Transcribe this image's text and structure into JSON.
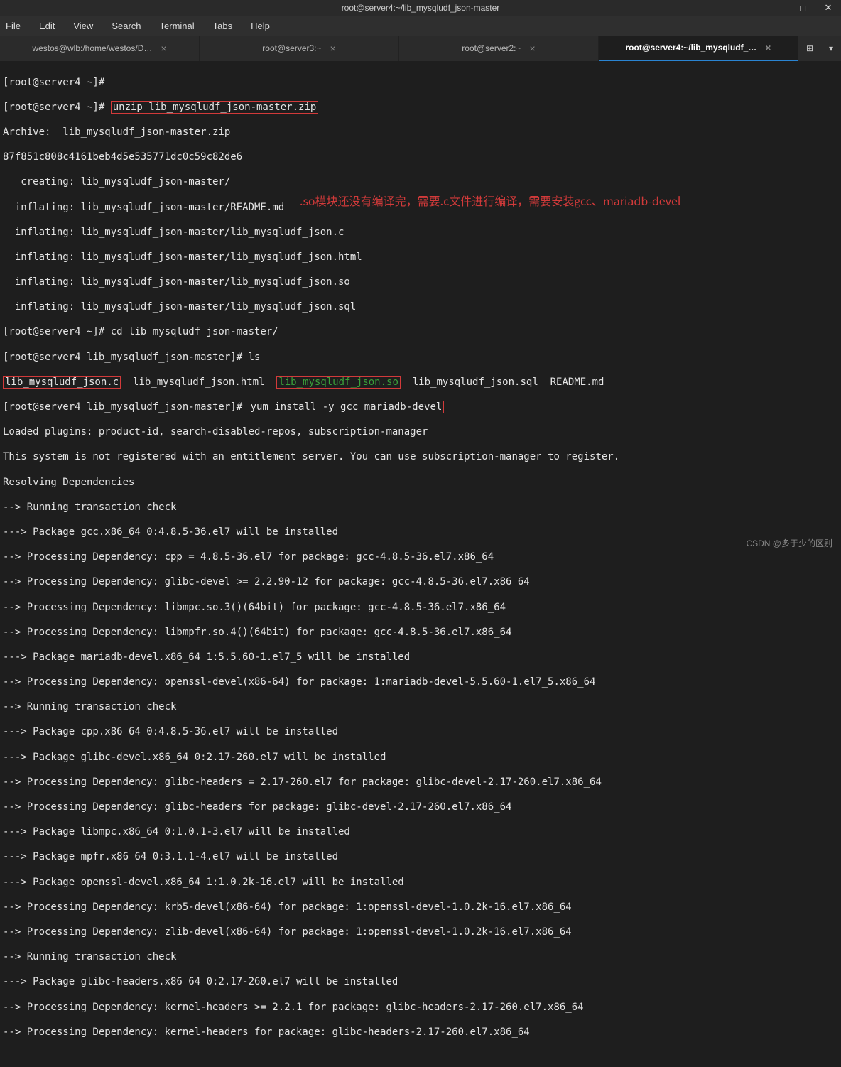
{
  "window": {
    "title": "root@server4:~/lib_mysqludf_json-master"
  },
  "menu": {
    "file": "File",
    "edit": "Edit",
    "view": "View",
    "search": "Search",
    "terminal": "Terminal",
    "tabs": "Tabs",
    "help": "Help"
  },
  "tabs": [
    {
      "label": "westos@wlb:/home/westos/D…",
      "active": false
    },
    {
      "label": "root@server3:~",
      "active": false
    },
    {
      "label": "root@server2:~",
      "active": false
    },
    {
      "label": "root@server4:~/lib_mysqludf_…",
      "active": true
    }
  ],
  "terminal": {
    "line01": "[root@server4 ~]#",
    "line02a": "[root@server4 ~]# ",
    "line02b": "unzip lib_mysqludf_json-master.zip",
    "line03": "Archive:  lib_mysqludf_json-master.zip",
    "line04": "87f851c808c4161beb4d5e535771dc0c59c82de6",
    "line05": "   creating: lib_mysqludf_json-master/",
    "line06": "  inflating: lib_mysqludf_json-master/README.md",
    "line07": "  inflating: lib_mysqludf_json-master/lib_mysqludf_json.c",
    "line08": "  inflating: lib_mysqludf_json-master/lib_mysqludf_json.html",
    "line09": "  inflating: lib_mysqludf_json-master/lib_mysqludf_json.so",
    "line10": "  inflating: lib_mysqludf_json-master/lib_mysqludf_json.sql",
    "line11": "[root@server4 ~]# cd lib_mysqludf_json-master/",
    "line12": "[root@server4 lib_mysqludf_json-master]# ls",
    "line13a": "lib_mysqludf_json.c",
    "line13b": "  lib_mysqludf_json.html  ",
    "line13c": "lib_mysqludf_json.so",
    "line13d": "  lib_mysqludf_json.sql  README.md",
    "line14a": "[root@server4 lib_mysqludf_json-master]# ",
    "line14b": "yum install -y gcc mariadb-devel",
    "line15": "Loaded plugins: product-id, search-disabled-repos, subscription-manager",
    "line16": "This system is not registered with an entitlement server. You can use subscription-manager to register.",
    "line17": "Resolving Dependencies",
    "line18": "--> Running transaction check",
    "line19": "---> Package gcc.x86_64 0:4.8.5-36.el7 will be installed",
    "line20": "--> Processing Dependency: cpp = 4.8.5-36.el7 for package: gcc-4.8.5-36.el7.x86_64",
    "line21": "--> Processing Dependency: glibc-devel >= 2.2.90-12 for package: gcc-4.8.5-36.el7.x86_64",
    "line22": "--> Processing Dependency: libmpc.so.3()(64bit) for package: gcc-4.8.5-36.el7.x86_64",
    "line23": "--> Processing Dependency: libmpfr.so.4()(64bit) for package: gcc-4.8.5-36.el7.x86_64",
    "line24": "---> Package mariadb-devel.x86_64 1:5.5.60-1.el7_5 will be installed",
    "line25": "--> Processing Dependency: openssl-devel(x86-64) for package: 1:mariadb-devel-5.5.60-1.el7_5.x86_64",
    "line26": "--> Running transaction check",
    "line27": "---> Package cpp.x86_64 0:4.8.5-36.el7 will be installed",
    "line28": "---> Package glibc-devel.x86_64 0:2.17-260.el7 will be installed",
    "line29": "--> Processing Dependency: glibc-headers = 2.17-260.el7 for package: glibc-devel-2.17-260.el7.x86_64",
    "line30": "--> Processing Dependency: glibc-headers for package: glibc-devel-2.17-260.el7.x86_64",
    "line31": "---> Package libmpc.x86_64 0:1.0.1-3.el7 will be installed",
    "line32": "---> Package mpfr.x86_64 0:3.1.1-4.el7 will be installed",
    "line33": "---> Package openssl-devel.x86_64 1:1.0.2k-16.el7 will be installed",
    "line34": "--> Processing Dependency: krb5-devel(x86-64) for package: 1:openssl-devel-1.0.2k-16.el7.x86_64",
    "line35": "--> Processing Dependency: zlib-devel(x86-64) for package: 1:openssl-devel-1.0.2k-16.el7.x86_64",
    "line36": "--> Running transaction check",
    "line37": "---> Package glibc-headers.x86_64 0:2.17-260.el7 will be installed",
    "line38": "--> Processing Dependency: kernel-headers >= 2.2.1 for package: glibc-headers-2.17-260.el7.x86_64",
    "line39": "--> Processing Dependency: kernel-headers for package: glibc-headers-2.17-260.el7.x86_64"
  },
  "annotation": ".so模块还没有编译完，需要.c文件进行编译，需要安装gcc、mariadb-devel",
  "watermark": "CSDN @多于少的区别"
}
